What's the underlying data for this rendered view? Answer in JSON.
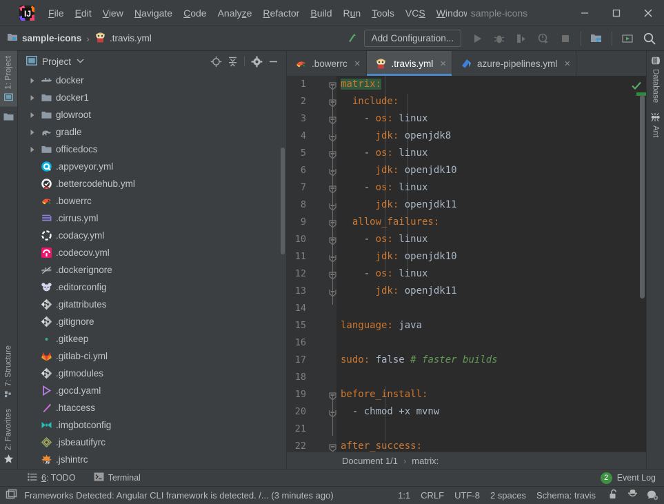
{
  "window": {
    "title": "sample-icons",
    "minimize_label": "Minimize",
    "maximize_label": "Maximize",
    "close_label": "Close"
  },
  "menu": [
    {
      "label": "File",
      "accel": "F"
    },
    {
      "label": "Edit",
      "accel": "E"
    },
    {
      "label": "View",
      "accel": "V"
    },
    {
      "label": "Navigate",
      "accel": "N"
    },
    {
      "label": "Code",
      "accel": "C"
    },
    {
      "label": "Analyze",
      "accel": "z"
    },
    {
      "label": "Refactor",
      "accel": "R"
    },
    {
      "label": "Build",
      "accel": "B"
    },
    {
      "label": "Run",
      "accel": "u"
    },
    {
      "label": "Tools",
      "accel": "T"
    },
    {
      "label": "VCS",
      "accel": "S"
    },
    {
      "label": "Window",
      "accel": "W"
    }
  ],
  "toolbar": {
    "breadcrumb_project": "sample-icons",
    "breadcrumb_sep": "›",
    "breadcrumb_file": ".travis.yml",
    "add_configuration": "Add Configuration...",
    "icons": [
      "build-icon",
      "run-icon",
      "debug-icon",
      "run-with-coverage-icon",
      "profile-icon",
      "stop-icon",
      "project-structure-icon",
      "update-icon",
      "search-icon"
    ]
  },
  "left_stripe": [
    {
      "label": "1: Project",
      "icon": "project-icon",
      "active": true
    },
    {
      "label": "7: Structure",
      "icon": "structure-icon",
      "active": false
    },
    {
      "label": "2: Favorites",
      "icon": "star-icon",
      "active": false
    }
  ],
  "right_stripe": [
    {
      "label": "Database",
      "icon": "database-icon"
    },
    {
      "label": "Ant",
      "icon": "ant-icon"
    }
  ],
  "project_panel": {
    "title": "Project",
    "caret": "▾",
    "actions": [
      "locate-icon",
      "collapse-all-icon",
      "settings-gear-icon",
      "hide-icon"
    ],
    "tree": [
      {
        "label": "docker",
        "icon": "docker-icon",
        "expandable": true,
        "indent": 0
      },
      {
        "label": "docker1",
        "icon": "folder-icon",
        "expandable": true,
        "indent": 0
      },
      {
        "label": "glowroot",
        "icon": "folder-icon",
        "expandable": true,
        "indent": 0
      },
      {
        "label": "gradle",
        "icon": "gradle-icon",
        "expandable": true,
        "indent": 0
      },
      {
        "label": "officedocs",
        "icon": "folder-icon",
        "expandable": true,
        "indent": 0
      },
      {
        "label": ".appveyor.yml",
        "icon": "appveyor-icon",
        "expandable": false,
        "indent": 0
      },
      {
        "label": ".bettercodehub.yml",
        "icon": "bettercodehub-icon",
        "expandable": false,
        "indent": 0
      },
      {
        "label": ".bowerrc",
        "icon": "bower-icon",
        "expandable": false,
        "indent": 0
      },
      {
        "label": ".cirrus.yml",
        "icon": "cirrus-icon",
        "expandable": false,
        "indent": 0
      },
      {
        "label": ".codacy.yml",
        "icon": "codacy-icon",
        "expandable": false,
        "indent": 0
      },
      {
        "label": ".codecov.yml",
        "icon": "codecov-icon",
        "expandable": false,
        "indent": 0
      },
      {
        "label": ".dockerignore",
        "icon": "dockerignore-icon",
        "expandable": false,
        "indent": 0
      },
      {
        "label": ".editorconfig",
        "icon": "editorconfig-icon",
        "expandable": false,
        "indent": 0
      },
      {
        "label": ".gitattributes",
        "icon": "git-icon",
        "expandable": false,
        "indent": 0
      },
      {
        "label": ".gitignore",
        "icon": "git-icon",
        "expandable": false,
        "indent": 0
      },
      {
        "label": ".gitkeep",
        "icon": "gitkeep-icon",
        "expandable": false,
        "indent": 0
      },
      {
        "label": ".gitlab-ci.yml",
        "icon": "gitlab-icon",
        "expandable": false,
        "indent": 0
      },
      {
        "label": ".gitmodules",
        "icon": "git-icon",
        "expandable": false,
        "indent": 0
      },
      {
        "label": ".gocd.yaml",
        "icon": "gocd-icon",
        "expandable": false,
        "indent": 0
      },
      {
        "label": ".htaccess",
        "icon": "htaccess-icon",
        "expandable": false,
        "indent": 0
      },
      {
        "label": ".imgbotconfig",
        "icon": "imgbot-icon",
        "expandable": false,
        "indent": 0
      },
      {
        "label": ".jsbeautifyrc",
        "icon": "jsbeautify-icon",
        "expandable": false,
        "indent": 0
      },
      {
        "label": ".jshintrc",
        "icon": "jshint-icon",
        "expandable": false,
        "indent": 0
      }
    ]
  },
  "editor": {
    "tabs": [
      {
        "label": ".bowerrc",
        "icon": "bower-icon",
        "active": false,
        "close": "×"
      },
      {
        "label": ".travis.yml",
        "icon": "travis-icon",
        "active": true,
        "close": "×"
      },
      {
        "label": "azure-pipelines.yml",
        "icon": "azure-icon",
        "active": false,
        "close": "×"
      }
    ],
    "lines": [
      {
        "n": 1,
        "indent": 0,
        "fold": "minus-top",
        "segs": [
          {
            "t": "matrix",
            "c": "k hl1"
          },
          {
            "t": ":",
            "c": "k hl1"
          }
        ]
      },
      {
        "n": 2,
        "indent": 1,
        "fold": "minus-mid",
        "segs": [
          {
            "t": "  include",
            "c": "k"
          },
          {
            "t": ":",
            "c": "k"
          }
        ]
      },
      {
        "n": 3,
        "indent": 2,
        "fold": "minus-mid",
        "segs": [
          {
            "t": "    - ",
            "c": "dash"
          },
          {
            "t": "os",
            "c": "k"
          },
          {
            "t": ": ",
            "c": "k"
          },
          {
            "t": "linux",
            "c": "v"
          }
        ]
      },
      {
        "n": 4,
        "indent": 2,
        "fold": "minus-end",
        "segs": [
          {
            "t": "      ",
            "c": "v"
          },
          {
            "t": "jdk",
            "c": "k"
          },
          {
            "t": ": ",
            "c": "k"
          },
          {
            "t": "openjdk8",
            "c": "v"
          }
        ]
      },
      {
        "n": 5,
        "indent": 2,
        "fold": "minus-mid",
        "segs": [
          {
            "t": "    - ",
            "c": "dash"
          },
          {
            "t": "os",
            "c": "k"
          },
          {
            "t": ": ",
            "c": "k"
          },
          {
            "t": "linux",
            "c": "v"
          }
        ]
      },
      {
        "n": 6,
        "indent": 2,
        "fold": "minus-end",
        "segs": [
          {
            "t": "      ",
            "c": "v"
          },
          {
            "t": "jdk",
            "c": "k"
          },
          {
            "t": ": ",
            "c": "k"
          },
          {
            "t": "openjdk10",
            "c": "v"
          }
        ]
      },
      {
        "n": 7,
        "indent": 2,
        "fold": "minus-mid",
        "segs": [
          {
            "t": "    - ",
            "c": "dash"
          },
          {
            "t": "os",
            "c": "k"
          },
          {
            "t": ": ",
            "c": "k"
          },
          {
            "t": "linux",
            "c": "v"
          }
        ]
      },
      {
        "n": 8,
        "indent": 2,
        "fold": "minus-end",
        "segs": [
          {
            "t": "      ",
            "c": "v"
          },
          {
            "t": "jdk",
            "c": "k"
          },
          {
            "t": ": ",
            "c": "k"
          },
          {
            "t": "openjdk11",
            "c": "v"
          }
        ]
      },
      {
        "n": 9,
        "indent": 1,
        "fold": "minus-mid",
        "segs": [
          {
            "t": "  allow_failures",
            "c": "k"
          },
          {
            "t": ":",
            "c": "k"
          }
        ]
      },
      {
        "n": 10,
        "indent": 2,
        "fold": "minus-mid",
        "segs": [
          {
            "t": "    - ",
            "c": "dash"
          },
          {
            "t": "os",
            "c": "k"
          },
          {
            "t": ": ",
            "c": "k"
          },
          {
            "t": "linux",
            "c": "v"
          }
        ]
      },
      {
        "n": 11,
        "indent": 2,
        "fold": "minus-end",
        "segs": [
          {
            "t": "      ",
            "c": "v"
          },
          {
            "t": "jdk",
            "c": "k"
          },
          {
            "t": ": ",
            "c": "k"
          },
          {
            "t": "openjdk10",
            "c": "v"
          }
        ]
      },
      {
        "n": 12,
        "indent": 2,
        "fold": "minus-mid",
        "segs": [
          {
            "t": "    - ",
            "c": "dash"
          },
          {
            "t": "os",
            "c": "k"
          },
          {
            "t": ": ",
            "c": "k"
          },
          {
            "t": "linux",
            "c": "v"
          }
        ]
      },
      {
        "n": 13,
        "indent": 2,
        "fold": "minus-end",
        "segs": [
          {
            "t": "      ",
            "c": "v"
          },
          {
            "t": "jdk",
            "c": "k"
          },
          {
            "t": ": ",
            "c": "k"
          },
          {
            "t": "openjdk11",
            "c": "v"
          }
        ]
      },
      {
        "n": 14,
        "indent": 0,
        "fold": "",
        "segs": []
      },
      {
        "n": 15,
        "indent": 0,
        "fold": "",
        "segs": [
          {
            "t": "language",
            "c": "k"
          },
          {
            "t": ": ",
            "c": "k"
          },
          {
            "t": "java",
            "c": "v"
          }
        ]
      },
      {
        "n": 16,
        "indent": 0,
        "fold": "",
        "segs": []
      },
      {
        "n": 17,
        "indent": 0,
        "fold": "",
        "segs": [
          {
            "t": "sudo",
            "c": "k"
          },
          {
            "t": ": ",
            "c": "k"
          },
          {
            "t": "false ",
            "c": "v"
          },
          {
            "t": "# faster builds",
            "c": "cm"
          }
        ]
      },
      {
        "n": 18,
        "indent": 0,
        "fold": "",
        "segs": []
      },
      {
        "n": 19,
        "indent": 0,
        "fold": "minus-top",
        "segs": [
          {
            "t": "before_install",
            "c": "k"
          },
          {
            "t": ":",
            "c": "k"
          }
        ]
      },
      {
        "n": 20,
        "indent": 1,
        "fold": "minus-end",
        "segs": [
          {
            "t": "  - ",
            "c": "dash"
          },
          {
            "t": "chmod +x mvnw",
            "c": "v"
          }
        ]
      },
      {
        "n": 21,
        "indent": 0,
        "fold": "",
        "segs": []
      },
      {
        "n": 22,
        "indent": 0,
        "fold": "minus-top",
        "segs": [
          {
            "t": "after_success",
            "c": "k"
          },
          {
            "t": ":",
            "c": "k"
          }
        ]
      }
    ],
    "inspection_status": "ok-checkmark",
    "bottom_breadcrumb": [
      "Document 1/1",
      "matrix:"
    ],
    "bottom_breadcrumb_sep": "›"
  },
  "tool_window_bar": {
    "buttons": [
      {
        "label": "6: TODO",
        "accel": "6",
        "icon": "todo-icon"
      },
      {
        "label": "Terminal",
        "accel": "",
        "icon": "terminal-icon"
      }
    ],
    "event_log": {
      "label": "Event Log",
      "count": "2"
    }
  },
  "status_bar": {
    "icon": "ide-message-icon",
    "message": "Frameworks Detected: Angular CLI framework is detected. /... (3 minutes ago)",
    "caret_position": "1:1",
    "line_separator": "CRLF",
    "encoding": "UTF-8",
    "indent": "2 spaces",
    "schema": "Schema: travis",
    "icons": [
      "unlocked-icon",
      "inspection-hat-icon",
      "notifications-icon"
    ]
  },
  "colors": {
    "chrome_bg": "#3c3f41",
    "editor_bg": "#2b2b2b",
    "gutter_bg": "#313335",
    "accent_tab": "#4a88c7",
    "keyword": "#cc7832",
    "text": "#a9b7c6",
    "comment": "#629755",
    "badge_green": "#3f9143",
    "highlight_green": "#32593d"
  }
}
